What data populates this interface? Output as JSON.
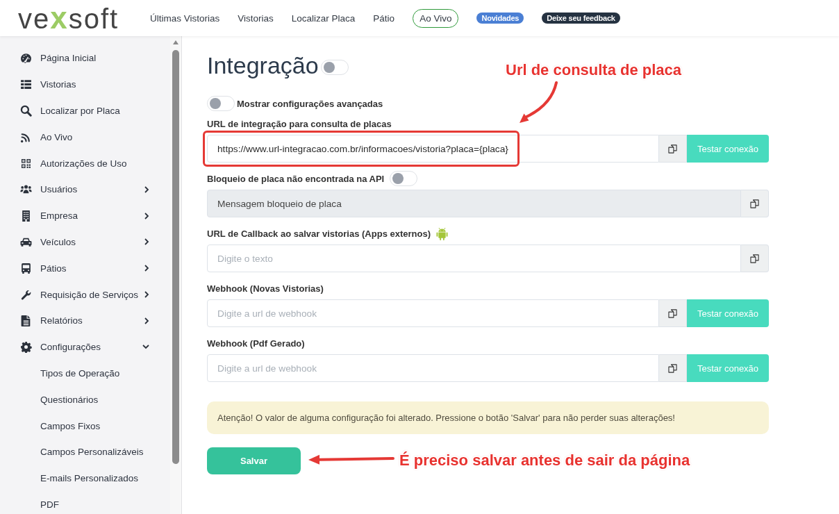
{
  "header": {
    "logo": {
      "start": "ve",
      "accent": "x",
      "end": "soft"
    },
    "nav": [
      {
        "label": "Últimas Vistorias",
        "kind": "link"
      },
      {
        "label": "Vistorias",
        "kind": "link"
      },
      {
        "label": "Localizar Placa",
        "kind": "link"
      },
      {
        "label": "Pátio",
        "kind": "link"
      },
      {
        "label": "Ao Vivo",
        "kind": "outline"
      },
      {
        "label": "Novidades",
        "kind": "badge",
        "color": "#4a7fd4"
      },
      {
        "label": "Deixe seu feedback",
        "kind": "badge",
        "color": "#253241"
      }
    ]
  },
  "sidebar": {
    "items": [
      {
        "label": "Página Inicial",
        "kind": "link"
      },
      {
        "label": "Vistorias",
        "kind": "link"
      },
      {
        "label": "Localizar por Placa",
        "kind": "link"
      },
      {
        "label": "Ao Vivo",
        "kind": "link"
      },
      {
        "label": "Autorizações de Uso",
        "kind": "link"
      },
      {
        "label": "Usuários",
        "kind": "group",
        "expanded": false
      },
      {
        "label": "Empresa",
        "kind": "group",
        "expanded": false
      },
      {
        "label": "Veículos",
        "kind": "group",
        "expanded": false
      },
      {
        "label": "Pátios",
        "kind": "group",
        "expanded": false
      },
      {
        "label": "Requisição de Serviços",
        "kind": "group",
        "expanded": false
      },
      {
        "label": "Relatórios",
        "kind": "group",
        "expanded": false
      },
      {
        "label": "Configurações",
        "kind": "group",
        "expanded": true,
        "children": [
          {
            "label": "Tipos de Operação"
          },
          {
            "label": "Questionários"
          },
          {
            "label": "Campos Fixos"
          },
          {
            "label": "Campos Personalizáveis"
          },
          {
            "label": "E-mails Personalizados"
          },
          {
            "label": "PDF"
          }
        ]
      }
    ]
  },
  "page": {
    "title": "Integração",
    "title_toggle": {
      "on": false
    },
    "advanced": {
      "label": "Mostrar configurações avançadas",
      "on": false
    },
    "fields": [
      {
        "kind": "test",
        "label": "URL de integração para consulta de placas",
        "value": "https://www.url-integracao.com.br/informacoes/vistoria?placa={placa}",
        "test_button": "Testar conexão",
        "highlighted": true,
        "disabled": false
      },
      {
        "kind": "toggle",
        "label": "Bloqueio de placa não encontrada na API",
        "on": false,
        "value": "Mensagem bloqueio de placa",
        "highlighted": false,
        "disabled": true
      },
      {
        "kind": "app",
        "label": "URL de Callback ao salvar vistorias (Apps externos)",
        "placeholder": "Digite o texto",
        "highlighted": false,
        "disabled": false
      },
      {
        "kind": "test",
        "label": "Webhook (Novas Vistorias)",
        "placeholder": "Digite a url de webhook",
        "test_button": "Testar conexão",
        "highlighted": false,
        "disabled": false
      },
      {
        "kind": "test",
        "label": "Webhook (Pdf Gerado)",
        "placeholder": "Digite a url de webhook",
        "test_button": "Testar conexão",
        "highlighted": false,
        "disabled": false
      }
    ],
    "alert": "Atenção! O valor de alguma configuração foi alterado. Pressione o botão 'Salvar' para não perder suas alterações!",
    "save_button": "Salvar"
  },
  "annotations": [
    {
      "text": "Url de consulta de placa"
    },
    {
      "text": "É preciso salvar antes de sair da página"
    }
  ]
}
